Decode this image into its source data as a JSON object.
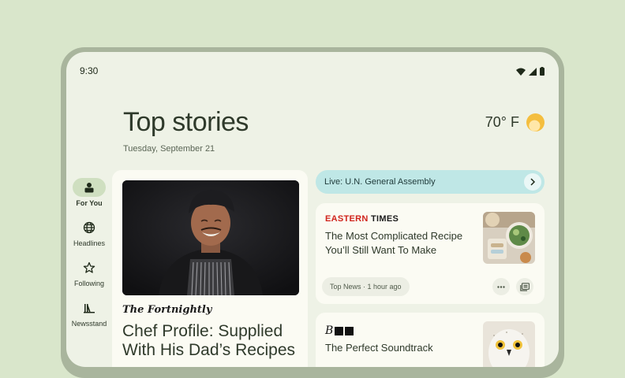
{
  "status": {
    "time": "9:30"
  },
  "header": {
    "title": "Top stories",
    "date": "Tuesday, September 21"
  },
  "weather": {
    "temp": "70° F",
    "icon": "sun-icon"
  },
  "nav": {
    "items": [
      {
        "label": "For You",
        "icon": "for-you-icon",
        "active": true
      },
      {
        "label": "Headlines",
        "icon": "globe-icon",
        "active": false
      },
      {
        "label": "Following",
        "icon": "star-icon",
        "active": false
      },
      {
        "label": "Newsstand",
        "icon": "newsstand-icon",
        "active": false
      }
    ]
  },
  "main_story": {
    "publisher": "The Fortnightly",
    "headline": "Chef Profile: Supplied With His Dad’s Recipes"
  },
  "live": {
    "label": "Live: U.N. General Assembly"
  },
  "story1": {
    "source_red": "EASTERN",
    "source_black": " TIMES",
    "headline": "The Most Complicated Recipe You’ll Still Want To Make",
    "meta": "Top News · 1 hour ago"
  },
  "story2": {
    "source": "B",
    "headline": "The Perfect Soundtrack"
  },
  "colors": {
    "background": "#d9e6cb",
    "screen": "#eef2e6",
    "card": "#fbfbf3",
    "live_banner": "#bfe7e6",
    "nav_active": "#cfdfc0",
    "brand_red": "#d0241c"
  }
}
